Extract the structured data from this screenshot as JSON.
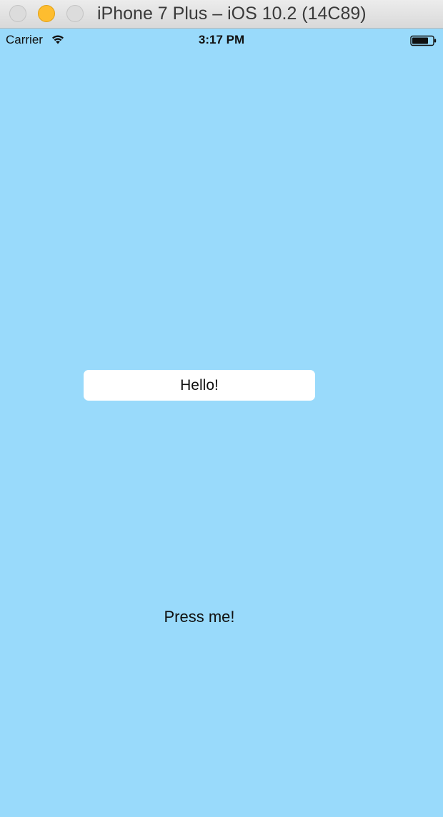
{
  "window": {
    "title": "iPhone 7 Plus – iOS 10.2 (14C89)",
    "traffic_lights": [
      "close",
      "minimize",
      "zoom"
    ]
  },
  "status_bar": {
    "carrier": "Carrier",
    "time": "3:17 PM",
    "icons": [
      "wifi-icon",
      "battery-icon"
    ]
  },
  "main": {
    "text_field_value": "Hello!",
    "button_label": "Press me!"
  },
  "colors": {
    "background": "#99dafb",
    "text_field": "#ffffff",
    "minimize_light": "#febd2f"
  }
}
